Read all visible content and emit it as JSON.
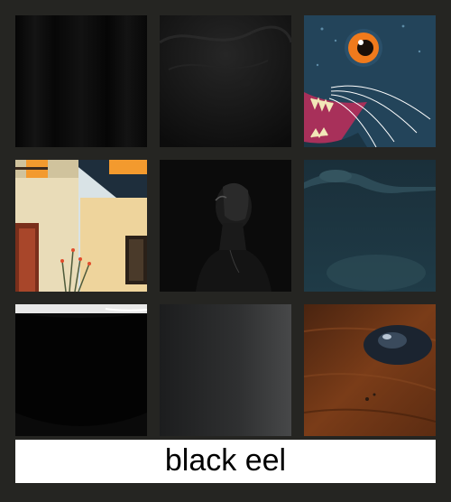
{
  "caption": {
    "text": "black eel"
  },
  "tiles": [
    {
      "subject": "black-curtain",
      "colors": {
        "base": "#0d0d0d"
      }
    },
    {
      "subject": "dark-water-texture",
      "colors": {
        "base": "#141414"
      }
    },
    {
      "subject": "cartoon-eel-face",
      "colors": {
        "base": "#1f3a4c",
        "eye": "#f07a1c",
        "mouth": "#a8305a"
      }
    },
    {
      "subject": "cream-house",
      "colors": {
        "wall": "#e9dcb8",
        "roof": "#1e2e3c",
        "window": "#f39a2e"
      }
    },
    {
      "subject": "portrait-in-shadow",
      "colors": {
        "base": "#0b0b0b"
      }
    },
    {
      "subject": "eel-in-teal-water",
      "colors": {
        "base": "#1d3440"
      }
    },
    {
      "subject": "black-bowl",
      "colors": {
        "base": "#050505"
      }
    },
    {
      "subject": "gray-gradient",
      "colors": {
        "base": "#2c2d2e"
      }
    },
    {
      "subject": "water-drop-on-wood",
      "colors": {
        "wood": "#6a3316",
        "drop": "#1b2430"
      }
    }
  ]
}
